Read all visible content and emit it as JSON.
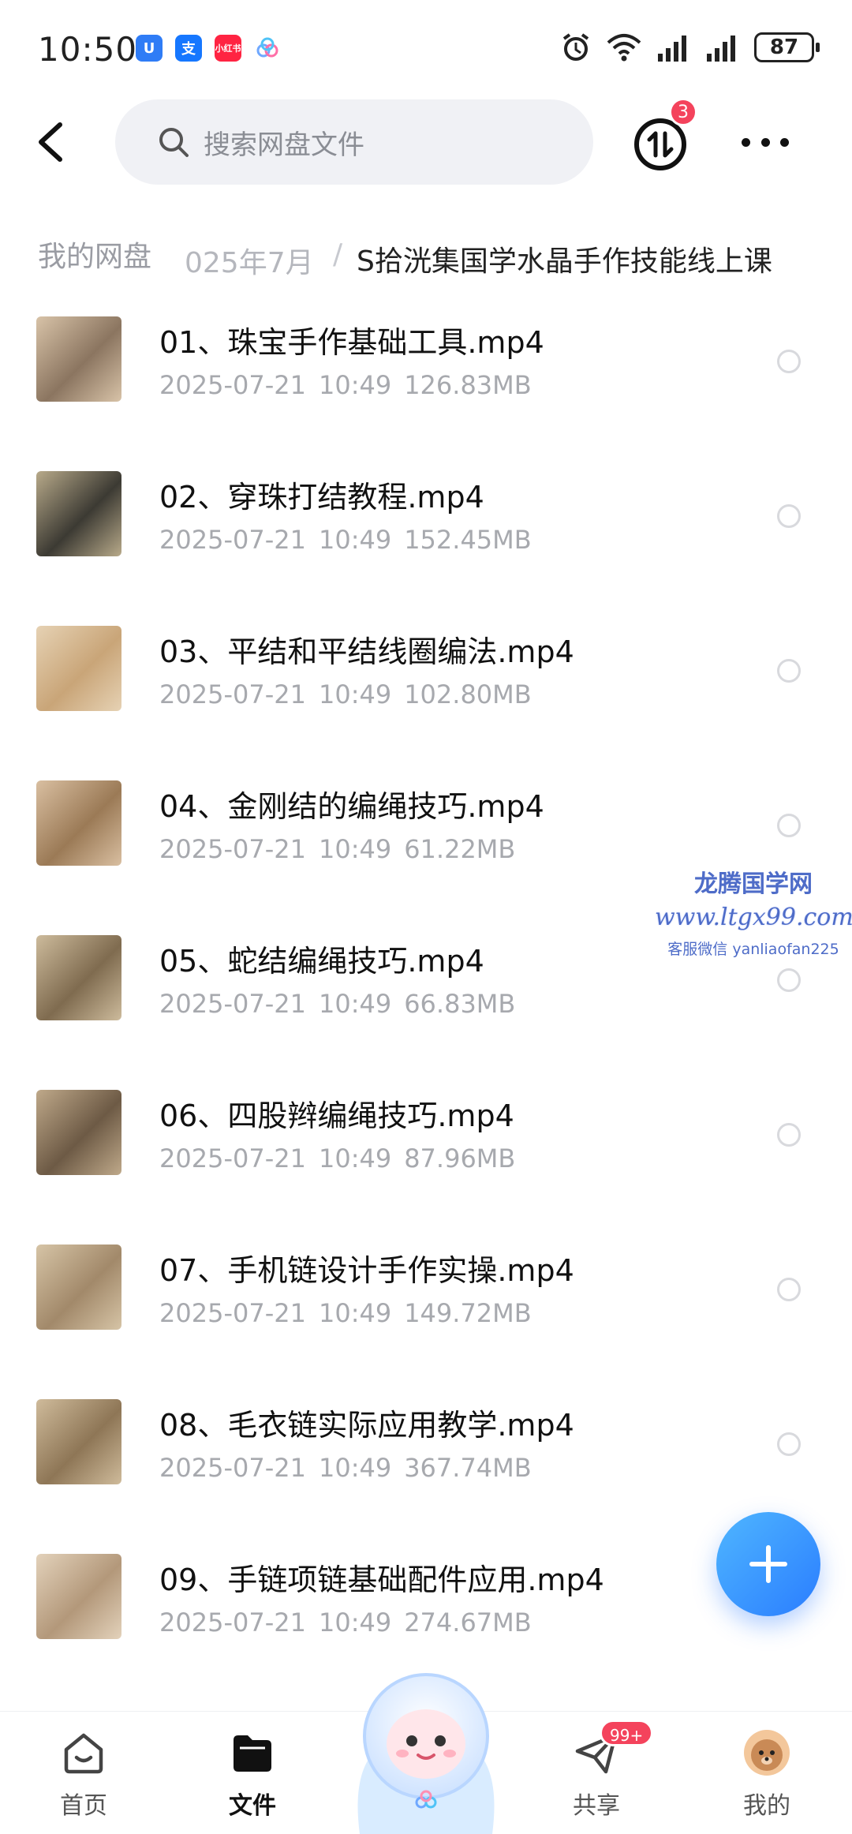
{
  "status_bar": {
    "time": "10:50",
    "apps": [
      {
        "icon": "security-app-icon",
        "glyph": "U",
        "color": "#2f7cf6"
      },
      {
        "icon": "alipay-app-icon",
        "glyph": "支",
        "color": "#1677ff"
      },
      {
        "icon": "xiaohongshu-app-icon",
        "glyph": "小红书",
        "color": "#ff2442"
      },
      {
        "icon": "cloud-app-icon",
        "glyph": "",
        "color": "#6fa8ff"
      }
    ],
    "battery": "87"
  },
  "header": {
    "search_placeholder": "搜索网盘文件",
    "transfer_badge": "3"
  },
  "breadcrumb": {
    "root": "我的网盘",
    "middle": "025年7月",
    "separator": "/",
    "current": "S拾洸集国学水晶手作技能线上课"
  },
  "files": [
    {
      "name": "01、珠宝手作基础工具.mp4",
      "date": "2025-07-21",
      "time": "10:49",
      "size": "126.83MB"
    },
    {
      "name": "02、穿珠打结教程.mp4",
      "date": "2025-07-21",
      "time": "10:49",
      "size": "152.45MB"
    },
    {
      "name": "03、平结和平结线圈编法.mp4",
      "date": "2025-07-21",
      "time": "10:49",
      "size": "102.80MB"
    },
    {
      "name": "04、金刚结的编绳技巧.mp4",
      "date": "2025-07-21",
      "time": "10:49",
      "size": "61.22MB"
    },
    {
      "name": "05、蛇结编绳技巧.mp4",
      "date": "2025-07-21",
      "time": "10:49",
      "size": "66.83MB"
    },
    {
      "name": "06、四股辫编绳技巧.mp4",
      "date": "2025-07-21",
      "time": "10:49",
      "size": "87.96MB"
    },
    {
      "name": "07、手机链设计手作实操.mp4",
      "date": "2025-07-21",
      "time": "10:49",
      "size": "149.72MB"
    },
    {
      "name": "08、毛衣链实际应用教学.mp4",
      "date": "2025-07-21",
      "time": "10:49",
      "size": "367.74MB"
    },
    {
      "name": "09、手链项链基础配件应用.mp4",
      "date": "2025-07-21",
      "time": "10:49",
      "size": "274.67MB"
    }
  ],
  "watermark": {
    "title": "龙腾国学网",
    "url": "www.ltgx99.com",
    "contact": "客服微信 yanliaofan225"
  },
  "bottom_nav": {
    "home": "首页",
    "files": "文件",
    "share": "共享",
    "share_badge": "99+",
    "mine": "我的"
  }
}
